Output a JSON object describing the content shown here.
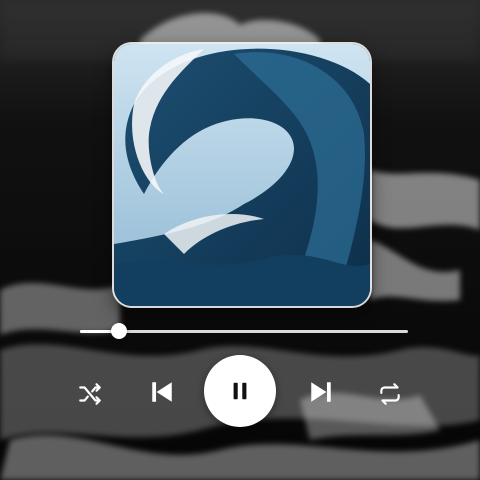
{
  "player": {
    "progress": 0.12,
    "playing": true
  },
  "icons": {
    "shuffle": "shuffle-icon",
    "previous": "skip-previous-icon",
    "play_pause": "pause-icon",
    "next": "skip-next-icon",
    "repeat": "repeat-icon"
  },
  "colors": {
    "controls": "#ffffff",
    "pause_glyph": "#111111",
    "track": "#ffffff"
  }
}
